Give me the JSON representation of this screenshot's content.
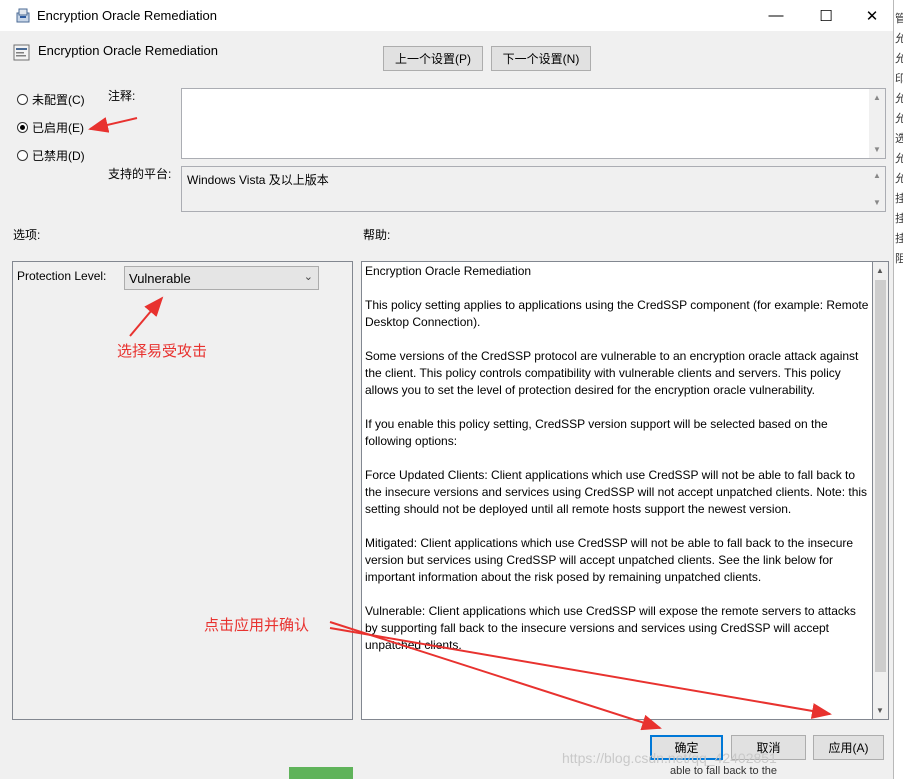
{
  "window": {
    "title": "Encryption Oracle Remediation",
    "controls": {
      "minimize": "—",
      "maximize": "☐",
      "close": "✕"
    }
  },
  "header": {
    "policy_title": "Encryption Oracle Remediation",
    "prev_button": "上一个设置(P)",
    "next_button": "下一个设置(N)"
  },
  "state": {
    "options": [
      {
        "label": "未配置(C)",
        "checked": false
      },
      {
        "label": "已启用(E)",
        "checked": true
      },
      {
        "label": "已禁用(D)",
        "checked": false
      }
    ]
  },
  "comment": {
    "label": "注释:",
    "value": ""
  },
  "platform": {
    "label": "支持的平台:",
    "value": "Windows Vista 及以上版本"
  },
  "options_section": {
    "label": "选项:",
    "protection_label": "Protection Level:",
    "protection_value": "Vulnerable"
  },
  "help_section": {
    "label": "帮助:",
    "paragraphs": [
      "Encryption Oracle Remediation",
      "This policy setting applies to applications using the CredSSP component (for example: Remote Desktop Connection).",
      "Some versions of the CredSSP protocol are vulnerable to an encryption oracle attack against the client.  This policy controls compatibility with vulnerable clients and servers.  This policy allows you to set the level of protection desired for the encryption oracle vulnerability.",
      "If you enable this policy setting, CredSSP version support will be selected based on the following options:",
      "Force Updated Clients: Client applications which use CredSSP will not be able to fall back to the insecure versions and services using CredSSP will not accept unpatched clients. Note: this setting should not be deployed until all remote hosts support the newest version.",
      "Mitigated: Client applications which use CredSSP will not be able to fall back to the insecure version but services using CredSSP will accept unpatched clients. See the link below for important information about the risk posed by remaining unpatched clients.",
      "Vulnerable: Client applications which use CredSSP will expose the remote servers to attacks by supporting fall back to the insecure versions and services using CredSSP will accept unpatched clients."
    ]
  },
  "footer": {
    "ok": "确定",
    "cancel": "取消",
    "apply": "应用(A)"
  },
  "annotations": {
    "select_vulnerable": "选择易受攻击",
    "click_apply": "点击应用并确认",
    "color": "#e8322f"
  },
  "watermark": "https://blog.csdn.net/qq_42402851",
  "background_window": {
    "side_chars": [
      "管",
      "允",
      "允",
      "印",
      "允",
      "允",
      "选",
      "允",
      "允",
      "挂",
      "挂",
      "挂",
      "阻"
    ],
    "bottom_text": "able to fall back to the"
  }
}
